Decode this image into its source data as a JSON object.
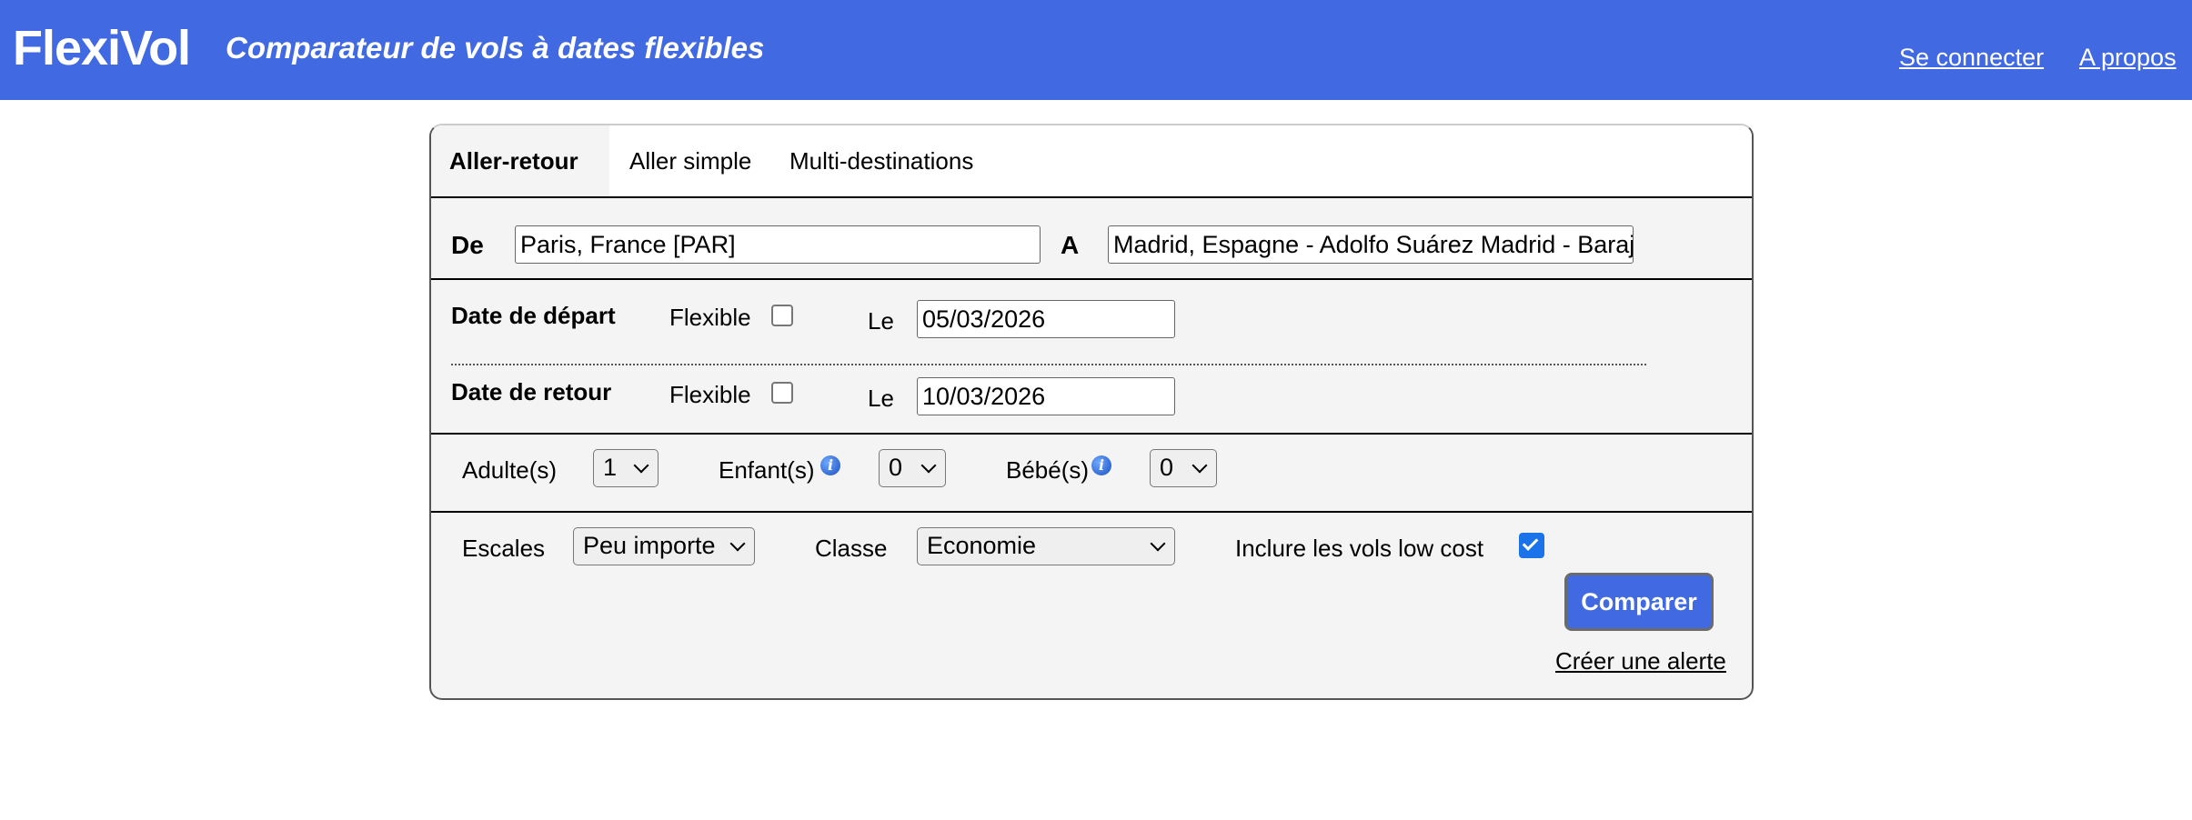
{
  "header": {
    "logo": "FlexiVol",
    "tagline": "Comparateur de vols à dates flexibles",
    "login_link": "Se connecter",
    "about_link": "A propos",
    "bg_color": "#4169e1"
  },
  "tabs": [
    {
      "label": "Aller-retour",
      "active": true
    },
    {
      "label": "Aller simple",
      "active": false
    },
    {
      "label": "Multi-destinations",
      "active": false
    }
  ],
  "route": {
    "from_label": "De",
    "from_value": "Paris, France [PAR]",
    "to_label": "A",
    "to_value": "Madrid, Espagne - Adolfo Suárez Madrid - Barajas"
  },
  "departure": {
    "label": "Date de départ",
    "flexible_label": "Flexible",
    "flexible_checked": false,
    "date_label": "Le",
    "date_value": "05/03/2026"
  },
  "return": {
    "label": "Date de retour",
    "flexible_label": "Flexible",
    "flexible_checked": false,
    "date_label": "Le",
    "date_value": "10/03/2026"
  },
  "passengers": {
    "adults_label": "Adulte(s)",
    "adults_value": "1",
    "children_label": "Enfant(s)",
    "children_value": "0",
    "babies_label": "Bébé(s)",
    "babies_value": "0",
    "info_icon": "i"
  },
  "options": {
    "stops_label": "Escales",
    "stops_value": "Peu importe",
    "class_label": "Classe",
    "class_value": "Economie",
    "lowcost_label": "Inclure les vols low cost",
    "lowcost_checked": true
  },
  "actions": {
    "compare_label": "Comparer",
    "alert_link": "Créer une alerte"
  }
}
